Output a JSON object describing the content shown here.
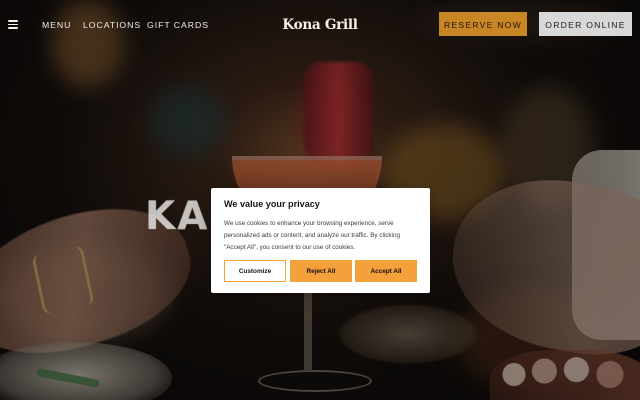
{
  "navigation": {
    "menu_icon": "hamburger-menu-icon",
    "menu": "MENU",
    "locations": "LOCATIONS",
    "gift_cards": "GIFT CARDS",
    "logo": "Kona Grill",
    "reserve_now": "RESERVE NOW",
    "order_online": "ORDER ONLINE"
  },
  "hero": {
    "visible_heading_text": "KAN MO"
  },
  "privacy_dialog": {
    "title": "We value your privacy",
    "message": "We use cookies to enhance your browsing experience, serve personalized ads or content, and analyze our traffic. By clicking \"Accept All\", you consent to our use of cookies.",
    "customize": "Customize",
    "reject_all": "Reject All",
    "accept_all": "Accept All"
  },
  "colors": {
    "reserve_button": "#c88625",
    "order_button": "#d8d8d8",
    "dialog_button_accent": "#f4a03b",
    "dialog_background": "#ffffff"
  }
}
